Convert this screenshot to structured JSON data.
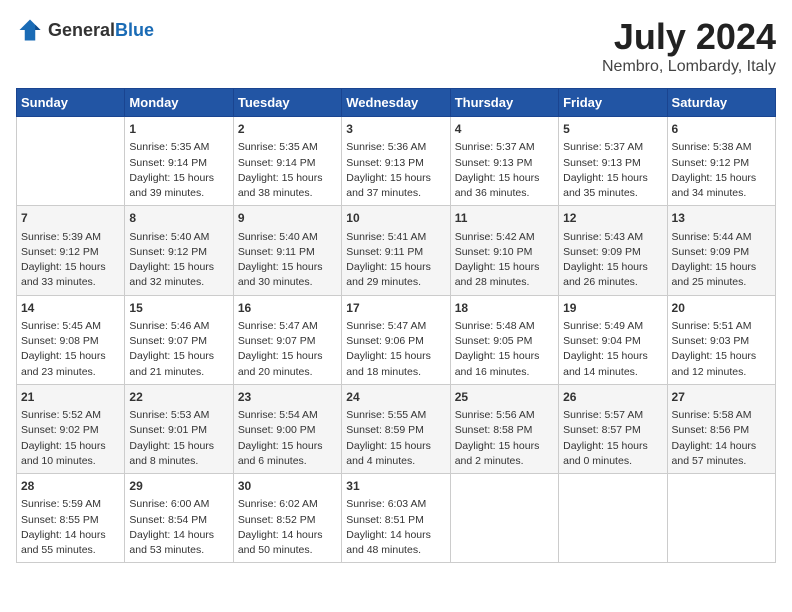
{
  "header": {
    "logo_general": "General",
    "logo_blue": "Blue",
    "month_year": "July 2024",
    "location": "Nembro, Lombardy, Italy"
  },
  "calendar": {
    "days_of_week": [
      "Sunday",
      "Monday",
      "Tuesday",
      "Wednesday",
      "Thursday",
      "Friday",
      "Saturday"
    ],
    "weeks": [
      [
        {
          "day": "",
          "content": ""
        },
        {
          "day": "1",
          "content": "Sunrise: 5:35 AM\nSunset: 9:14 PM\nDaylight: 15 hours\nand 39 minutes."
        },
        {
          "day": "2",
          "content": "Sunrise: 5:35 AM\nSunset: 9:14 PM\nDaylight: 15 hours\nand 38 minutes."
        },
        {
          "day": "3",
          "content": "Sunrise: 5:36 AM\nSunset: 9:13 PM\nDaylight: 15 hours\nand 37 minutes."
        },
        {
          "day": "4",
          "content": "Sunrise: 5:37 AM\nSunset: 9:13 PM\nDaylight: 15 hours\nand 36 minutes."
        },
        {
          "day": "5",
          "content": "Sunrise: 5:37 AM\nSunset: 9:13 PM\nDaylight: 15 hours\nand 35 minutes."
        },
        {
          "day": "6",
          "content": "Sunrise: 5:38 AM\nSunset: 9:12 PM\nDaylight: 15 hours\nand 34 minutes."
        }
      ],
      [
        {
          "day": "7",
          "content": "Sunrise: 5:39 AM\nSunset: 9:12 PM\nDaylight: 15 hours\nand 33 minutes."
        },
        {
          "day": "8",
          "content": "Sunrise: 5:40 AM\nSunset: 9:12 PM\nDaylight: 15 hours\nand 32 minutes."
        },
        {
          "day": "9",
          "content": "Sunrise: 5:40 AM\nSunset: 9:11 PM\nDaylight: 15 hours\nand 30 minutes."
        },
        {
          "day": "10",
          "content": "Sunrise: 5:41 AM\nSunset: 9:11 PM\nDaylight: 15 hours\nand 29 minutes."
        },
        {
          "day": "11",
          "content": "Sunrise: 5:42 AM\nSunset: 9:10 PM\nDaylight: 15 hours\nand 28 minutes."
        },
        {
          "day": "12",
          "content": "Sunrise: 5:43 AM\nSunset: 9:09 PM\nDaylight: 15 hours\nand 26 minutes."
        },
        {
          "day": "13",
          "content": "Sunrise: 5:44 AM\nSunset: 9:09 PM\nDaylight: 15 hours\nand 25 minutes."
        }
      ],
      [
        {
          "day": "14",
          "content": "Sunrise: 5:45 AM\nSunset: 9:08 PM\nDaylight: 15 hours\nand 23 minutes."
        },
        {
          "day": "15",
          "content": "Sunrise: 5:46 AM\nSunset: 9:07 PM\nDaylight: 15 hours\nand 21 minutes."
        },
        {
          "day": "16",
          "content": "Sunrise: 5:47 AM\nSunset: 9:07 PM\nDaylight: 15 hours\nand 20 minutes."
        },
        {
          "day": "17",
          "content": "Sunrise: 5:47 AM\nSunset: 9:06 PM\nDaylight: 15 hours\nand 18 minutes."
        },
        {
          "day": "18",
          "content": "Sunrise: 5:48 AM\nSunset: 9:05 PM\nDaylight: 15 hours\nand 16 minutes."
        },
        {
          "day": "19",
          "content": "Sunrise: 5:49 AM\nSunset: 9:04 PM\nDaylight: 15 hours\nand 14 minutes."
        },
        {
          "day": "20",
          "content": "Sunrise: 5:51 AM\nSunset: 9:03 PM\nDaylight: 15 hours\nand 12 minutes."
        }
      ],
      [
        {
          "day": "21",
          "content": "Sunrise: 5:52 AM\nSunset: 9:02 PM\nDaylight: 15 hours\nand 10 minutes."
        },
        {
          "day": "22",
          "content": "Sunrise: 5:53 AM\nSunset: 9:01 PM\nDaylight: 15 hours\nand 8 minutes."
        },
        {
          "day": "23",
          "content": "Sunrise: 5:54 AM\nSunset: 9:00 PM\nDaylight: 15 hours\nand 6 minutes."
        },
        {
          "day": "24",
          "content": "Sunrise: 5:55 AM\nSunset: 8:59 PM\nDaylight: 15 hours\nand 4 minutes."
        },
        {
          "day": "25",
          "content": "Sunrise: 5:56 AM\nSunset: 8:58 PM\nDaylight: 15 hours\nand 2 minutes."
        },
        {
          "day": "26",
          "content": "Sunrise: 5:57 AM\nSunset: 8:57 PM\nDaylight: 15 hours\nand 0 minutes."
        },
        {
          "day": "27",
          "content": "Sunrise: 5:58 AM\nSunset: 8:56 PM\nDaylight: 14 hours\nand 57 minutes."
        }
      ],
      [
        {
          "day": "28",
          "content": "Sunrise: 5:59 AM\nSunset: 8:55 PM\nDaylight: 14 hours\nand 55 minutes."
        },
        {
          "day": "29",
          "content": "Sunrise: 6:00 AM\nSunset: 8:54 PM\nDaylight: 14 hours\nand 53 minutes."
        },
        {
          "day": "30",
          "content": "Sunrise: 6:02 AM\nSunset: 8:52 PM\nDaylight: 14 hours\nand 50 minutes."
        },
        {
          "day": "31",
          "content": "Sunrise: 6:03 AM\nSunset: 8:51 PM\nDaylight: 14 hours\nand 48 minutes."
        },
        {
          "day": "",
          "content": ""
        },
        {
          "day": "",
          "content": ""
        },
        {
          "day": "",
          "content": ""
        }
      ]
    ]
  }
}
